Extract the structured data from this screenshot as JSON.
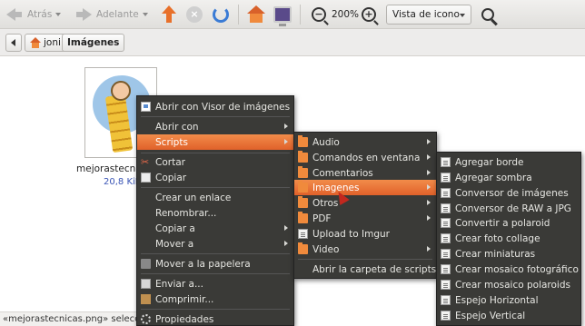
{
  "toolbar": {
    "back_label": "Atrás",
    "forward_label": "Adelante",
    "zoom_level": "200%",
    "view_mode": "Vista de icono"
  },
  "pathbar": {
    "crumbs": [
      "joni",
      "Imágenes"
    ]
  },
  "file": {
    "name": "mejorastecnicas",
    "size": "20,8 KiB"
  },
  "status_text": "«mejorastecnicas.png» seleccionado",
  "context_menu": {
    "items": [
      {
        "label": "Abrir con Visor de imágenes",
        "icon": "image-viewer-icon"
      },
      {
        "label": "Abrir con",
        "submenu": true
      },
      {
        "label": "Scripts",
        "submenu": true,
        "highlighted": true
      },
      {
        "label": "Cortar",
        "icon": "scissors-icon"
      },
      {
        "label": "Copiar",
        "icon": "copy-icon"
      },
      {
        "label": "Crear un enlace"
      },
      {
        "label": "Renombrar..."
      },
      {
        "label": "Copiar a",
        "submenu": true
      },
      {
        "label": "Mover a",
        "submenu": true
      },
      {
        "label": "Mover a la papelera",
        "icon": "trash-icon"
      },
      {
        "label": "Enviar a...",
        "icon": "mail-icon"
      },
      {
        "label": "Comprimir...",
        "icon": "archive-icon"
      },
      {
        "label": "Propiedades",
        "icon": "properties-icon"
      }
    ]
  },
  "scripts_menu": {
    "items": [
      {
        "label": "Audio",
        "submenu": true
      },
      {
        "label": "Comandos en ventana",
        "submenu": true
      },
      {
        "label": "Comentarios",
        "submenu": true
      },
      {
        "label": "Imagenes",
        "submenu": true,
        "highlighted": true
      },
      {
        "label": "Otros",
        "submenu": true
      },
      {
        "label": "PDF",
        "submenu": true
      },
      {
        "label": "Upload to Imgur"
      },
      {
        "label": "Video",
        "submenu": true
      },
      {
        "label": "Abrir la carpeta de scripts"
      }
    ]
  },
  "imagenes_menu": {
    "items": [
      "Agregar borde",
      "Agregar sombra",
      "Conversor de imágenes",
      "Conversor de RAW a JPG",
      "Convertir a polaroid",
      "Crear foto collage",
      "Crear miniaturas",
      "Crear mosaico fotográfico",
      "Crear mosaico polaroids",
      "Espejo Horizontal",
      "Espejo Vertical"
    ]
  },
  "colors": {
    "menu_bg": "#3a3a37",
    "highlight": "#e86e32",
    "folder": "#f08a3c"
  }
}
